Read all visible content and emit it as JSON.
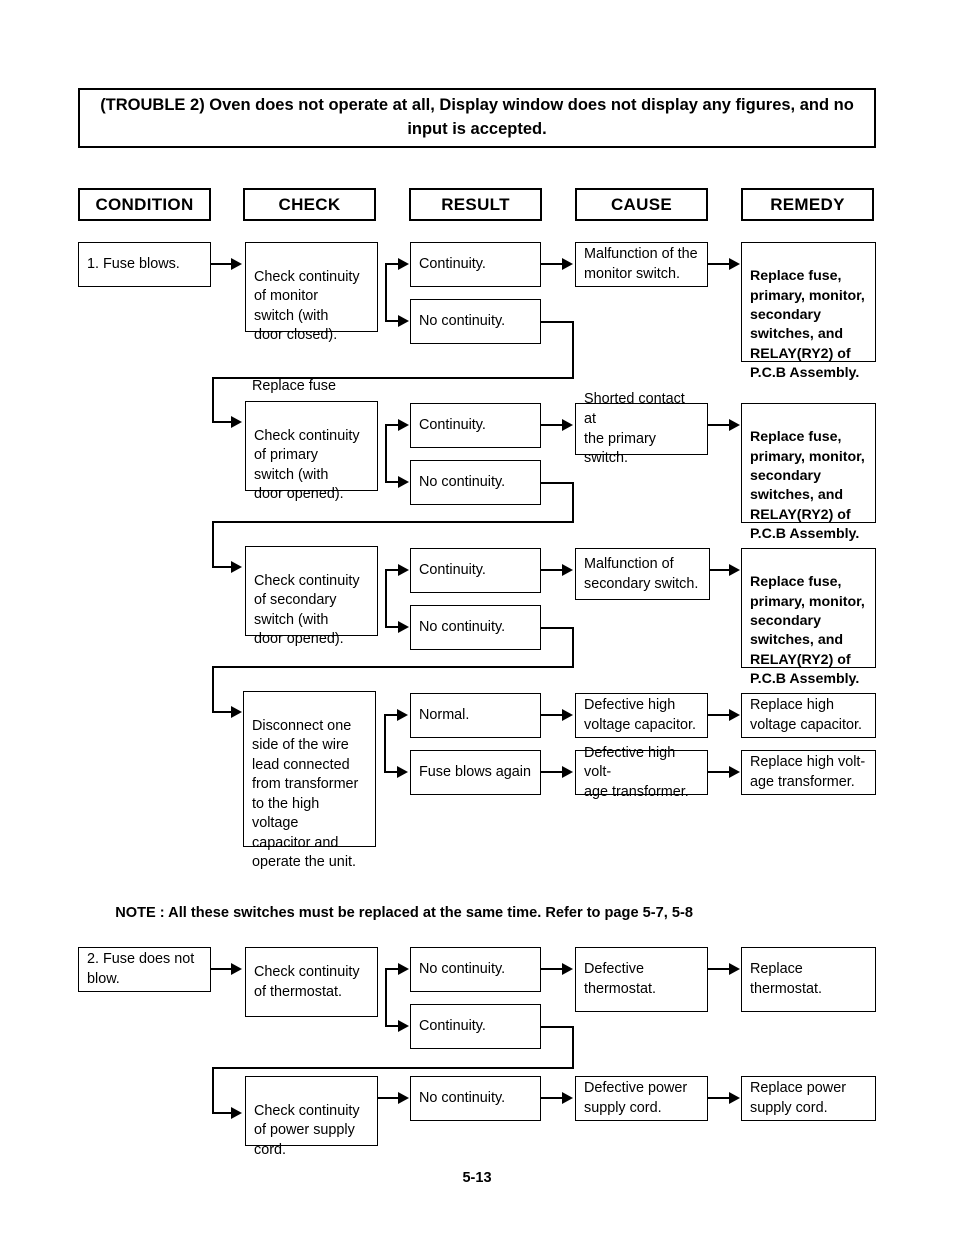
{
  "document": {
    "page_number": "5-13",
    "title": "(TROUBLE 2) Oven does not operate at all, Display window does not display any figures, and no input is accepted.",
    "note": "NOTE : All these switches must be replaced at the same time. Refer to page 5-7, 5-8"
  },
  "columns": [
    {
      "label": "CONDITION"
    },
    {
      "label": "CHECK"
    },
    {
      "label": "RESULT"
    },
    {
      "label": "CAUSE"
    },
    {
      "label": "REMEDY"
    }
  ],
  "labels": {
    "replace_fuse": "Replace fuse"
  },
  "conditions": [
    {
      "text": "1. Fuse blows."
    },
    {
      "text": "2. Fuse does not\n          blow."
    }
  ],
  "rows": [
    {
      "id": "monitor-switch",
      "check": "Check continuity\nof monitor\nswitch (with\ndoor closed).",
      "results": [
        {
          "text": "Continuity.",
          "leads_to_cause": true
        },
        {
          "text": "No continuity.",
          "leads_to_cause": false
        }
      ],
      "cause": "Malfunction of the\nmonitor switch.",
      "remedy": "Replace fuse,\nprimary, monitor,\nsecondary\nswitches, and\nRELAY(RY2) of\nP.C.B Assembly.",
      "remedy_bold": true
    },
    {
      "id": "primary-switch",
      "check": "Check continuity\nof primary\nswitch (with\ndoor opened).",
      "results": [
        {
          "text": "Continuity.",
          "leads_to_cause": true
        },
        {
          "text": "No continuity.",
          "leads_to_cause": false
        }
      ],
      "cause": "Shorted contact at\nthe primary switch.",
      "remedy": "Replace fuse,\nprimary, monitor,\nsecondary\nswitches, and\nRELAY(RY2) of\nP.C.B Assembly.",
      "remedy_bold": true
    },
    {
      "id": "secondary-switch",
      "check": "Check continuity\nof secondary\nswitch (with\ndoor opened).",
      "results": [
        {
          "text": "Continuity.",
          "leads_to_cause": true
        },
        {
          "text": "No continuity.",
          "leads_to_cause": false
        }
      ],
      "cause": "Malfunction of\nsecondary switch.",
      "remedy": "Replace fuse,\nprimary, monitor,\nsecondary\nswitches, and\nRELAY(RY2) of\nP.C.B Assembly.",
      "remedy_bold": true
    },
    {
      "id": "hv-capacitor",
      "check": "Disconnect one\nside of the wire\nlead connected\nfrom transformer\nto the high\nvoltage\ncapacitor and\noperate the unit.",
      "results": [
        {
          "text": "Normal.",
          "leads_to_cause": true
        },
        {
          "text": "Fuse blows again",
          "leads_to_cause": true
        }
      ],
      "causes": [
        "Defective high\nvoltage capacitor.",
        "Defective high volt-\nage transformer."
      ],
      "remedies": [
        "Replace high\nvoltage capacitor.",
        "Replace high volt-\nage transformer."
      ],
      "remedy_bold": false
    },
    {
      "id": "thermostat",
      "check": "Check continuity\nof thermostat.",
      "results": [
        {
          "text": "No continuity.",
          "leads_to_cause": true
        },
        {
          "text": "Continuity.",
          "leads_to_cause": false
        }
      ],
      "cause": "Defective\nthermostat.",
      "remedy": "Replace\nthermostat.",
      "remedy_bold": false
    },
    {
      "id": "power-supply-cord",
      "check": "Check continuity\nof power  supply\ncord.",
      "results": [
        {
          "text": "No continuity.",
          "leads_to_cause": true
        }
      ],
      "cause": "Defective power\nsupply cord.",
      "remedy": "Replace power\nsupply cord.",
      "remedy_bold": false
    }
  ]
}
